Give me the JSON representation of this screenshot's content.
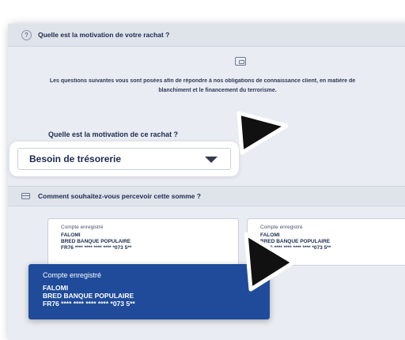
{
  "section1": {
    "title": "Quelle est la motivation de votre rachat ?",
    "info_line1": "Les questions suivantes vous sont posées afin de répondre à nos obligations de connaissance client, en matière de",
    "info_line2": "blanchiment et le financement du terrorisme.",
    "question": "Quelle est la motivation de ce rachat ?",
    "select_value": "Besoin de trésorerie"
  },
  "section2": {
    "title": "Comment souhaitez-vous percevoir cette somme ?"
  },
  "accounts": [
    {
      "label": "Compte enregistré",
      "name": "FALOMI",
      "bank": "BRED BANQUE POPULAIRE",
      "iban": "FR76 **** **** **** **** *073 5**"
    },
    {
      "label": "Compte enregistré",
      "name": "FALOMI",
      "bank": "BRED BANQUE POPULAIRE",
      "iban": "FR76 **** **** **** **** *073 5**"
    }
  ],
  "selected_account": {
    "label": "Compte enregistré",
    "name": "FALOMI",
    "bank": "BRED BANQUE POPULAIRE",
    "iban": "FR76 **** **** **** **** *073 5**"
  },
  "colors": {
    "selected_bg": "#1f4b9a",
    "panel_bg": "#e9ecf2",
    "header_bg": "#dfe3ea"
  }
}
